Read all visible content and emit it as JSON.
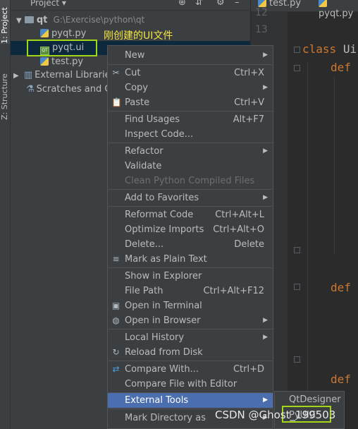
{
  "tool_strip": {
    "project_tab": "1: Project",
    "structure_tab": "Z: Structure"
  },
  "project_panel": {
    "title": "Project",
    "tree": {
      "root_name": "qt",
      "root_path": "G:\\Exercise\\python\\qt",
      "files": [
        "pyqt.py",
        "pyqt.ui",
        "test.py"
      ],
      "external_libraries": "External Libraries",
      "scratches": "Scratches and Co"
    },
    "annotation": "刚创建的UI文件"
  },
  "editor": {
    "tabs": [
      "test.py",
      "pyqt.py"
    ],
    "line_numbers": [
      "12",
      "13"
    ],
    "code": {
      "class_kw": "class",
      "class_name": "Ui",
      "def_kw": "def"
    }
  },
  "context_menu": {
    "items": [
      {
        "label": "New",
        "shortcut": "",
        "submenu": true
      },
      {
        "label": "Cut",
        "shortcut": "Ctrl+X",
        "icon": "✂"
      },
      {
        "label": "Copy",
        "shortcut": "",
        "submenu": true
      },
      {
        "label": "Paste",
        "shortcut": "Ctrl+V",
        "icon": "📋"
      },
      {
        "label": "Find Usages",
        "shortcut": "Alt+F7"
      },
      {
        "label": "Inspect Code..."
      },
      {
        "label": "Refactor",
        "submenu": true
      },
      {
        "label": "Validate"
      },
      {
        "label": "Clean Python Compiled Files",
        "disabled": true
      },
      {
        "label": "Add to Favorites",
        "submenu": true
      },
      {
        "label": "Reformat Code",
        "shortcut": "Ctrl+Alt+L"
      },
      {
        "label": "Optimize Imports",
        "shortcut": "Ctrl+Alt+O"
      },
      {
        "label": "Delete...",
        "shortcut": "Delete"
      },
      {
        "label": "Mark as Plain Text",
        "icon": "≡"
      },
      {
        "label": "Show in Explorer"
      },
      {
        "label": "File Path",
        "shortcut": "Ctrl+Alt+F12"
      },
      {
        "label": "Open in Terminal",
        "icon": "▣"
      },
      {
        "label": "Open in Browser",
        "submenu": true,
        "icon": "◍"
      },
      {
        "label": "Local History",
        "submenu": true
      },
      {
        "label": "Reload from Disk",
        "icon": "↻"
      },
      {
        "label": "Compare With...",
        "shortcut": "Ctrl+D",
        "icon": "⇄"
      },
      {
        "label": "Compare File with Editor"
      },
      {
        "label": "External Tools",
        "submenu": true,
        "highlighted": true
      },
      {
        "label": "Mark Directory as",
        "submenu": true
      }
    ]
  },
  "submenu": {
    "items": [
      "QtDesigner",
      "PyUIC"
    ]
  },
  "watermark": "CSDN @Ghost_199503",
  "colors": {
    "highlight": "#4b6eaf",
    "annotation_box": "#a3d617",
    "keyword": "#cc7832",
    "annotation_text": "#f5e642"
  }
}
